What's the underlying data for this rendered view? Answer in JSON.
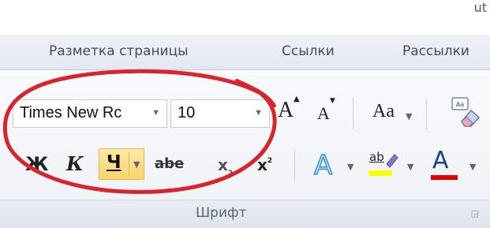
{
  "top_fragment": "ut",
  "tabs": [
    "Разметка страницы",
    "Ссылки",
    "Рассылки"
  ],
  "font": {
    "family": "Times New Rc",
    "size": "10",
    "grow_glyph": "A",
    "shrink_glyph": "A",
    "case_glyph": "Aa",
    "bold": "Ж",
    "italic": "К",
    "underline": "Ч",
    "strikethrough": "abe",
    "subscript": "x",
    "subscript_mark": "2",
    "superscript": "x",
    "superscript_mark": "2",
    "text_effects_glyph": "A",
    "highlight_glyph": "ab",
    "font_color_glyph": "A"
  },
  "group_label": "Шрифт",
  "colors": {
    "highlight": "#ffff00",
    "font_color": "#e00000",
    "annotation": "#d9232d",
    "active_button": "#fbd46b"
  },
  "icons": [
    "clear-formatting-icon",
    "dropdown-arrow-icon",
    "dialog-launcher-icon"
  ]
}
